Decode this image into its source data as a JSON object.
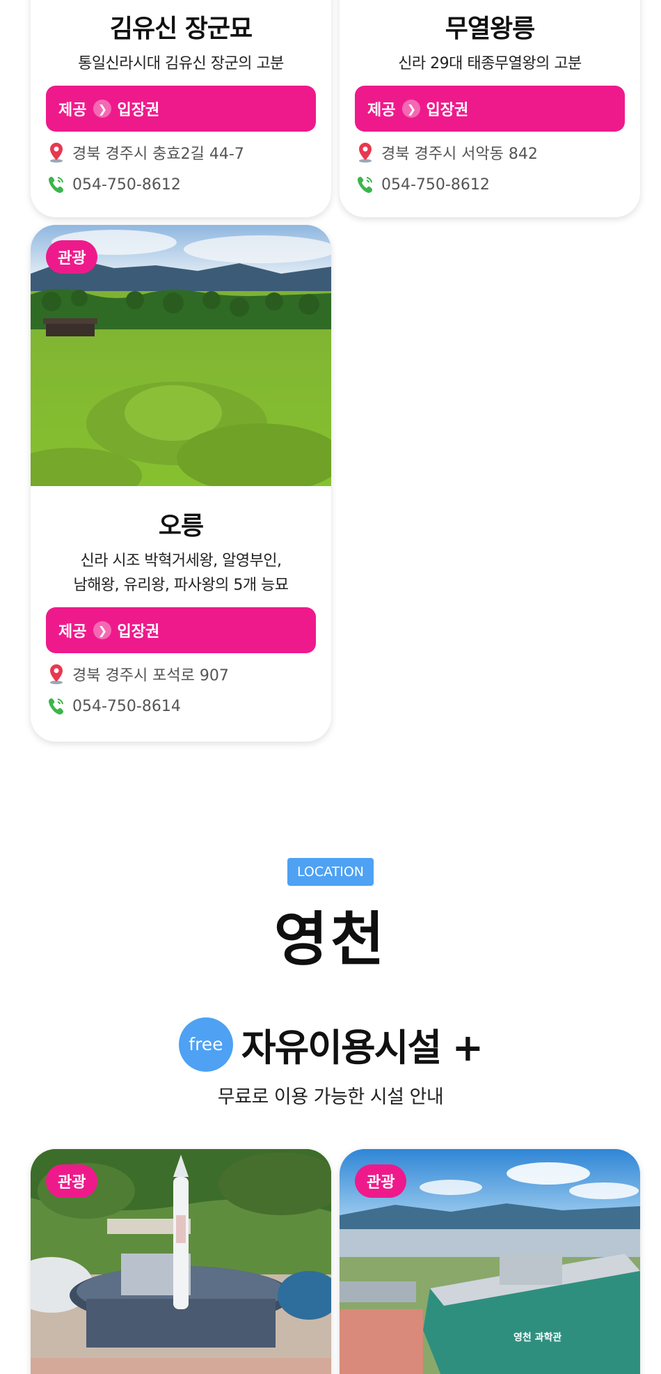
{
  "cards_top": [
    {
      "title": "김유신 장군묘",
      "desc": "통일신라시대 김유신 장군의 고분",
      "provide_label": "제공",
      "ticket_label": "입장권",
      "address": "경북 경주시 충효2길 44-7",
      "phone": "054-750-8612"
    },
    {
      "title": "무열왕릉",
      "desc": "신라 29대 태종무열왕의 고분",
      "provide_label": "제공",
      "ticket_label": "입장권",
      "address": "경북 경주시 서악동 842",
      "phone": "054-750-8612"
    }
  ],
  "card_oreung": {
    "badge": "관광",
    "title": "오릉",
    "desc_line1": "신라 시조 박혁거세왕, 알영부인,",
    "desc_line2": "남해왕, 유리왕, 파사왕의 5개 능묘",
    "provide_label": "제공",
    "ticket_label": "입장권",
    "address": "경북 경주시 포석로 907",
    "phone": "054-750-8614"
  },
  "section": {
    "location_tag": "LOCATION",
    "region": "영천",
    "free_badge": "free",
    "free_title": "자유이용시설 +",
    "free_subtitle": "무료로 이용 가능한 시설 안내"
  },
  "cards_bottom": [
    {
      "badge": "관광"
    },
    {
      "badge": "관광"
    }
  ],
  "colors": {
    "brand_pink": "#ee1a8b",
    "accent_blue": "#4ea1f3",
    "pin_red": "#e8384f",
    "phone_green": "#3bb54a"
  },
  "icons": [
    "location-pin-icon",
    "phone-icon",
    "chevron-right-icon"
  ]
}
